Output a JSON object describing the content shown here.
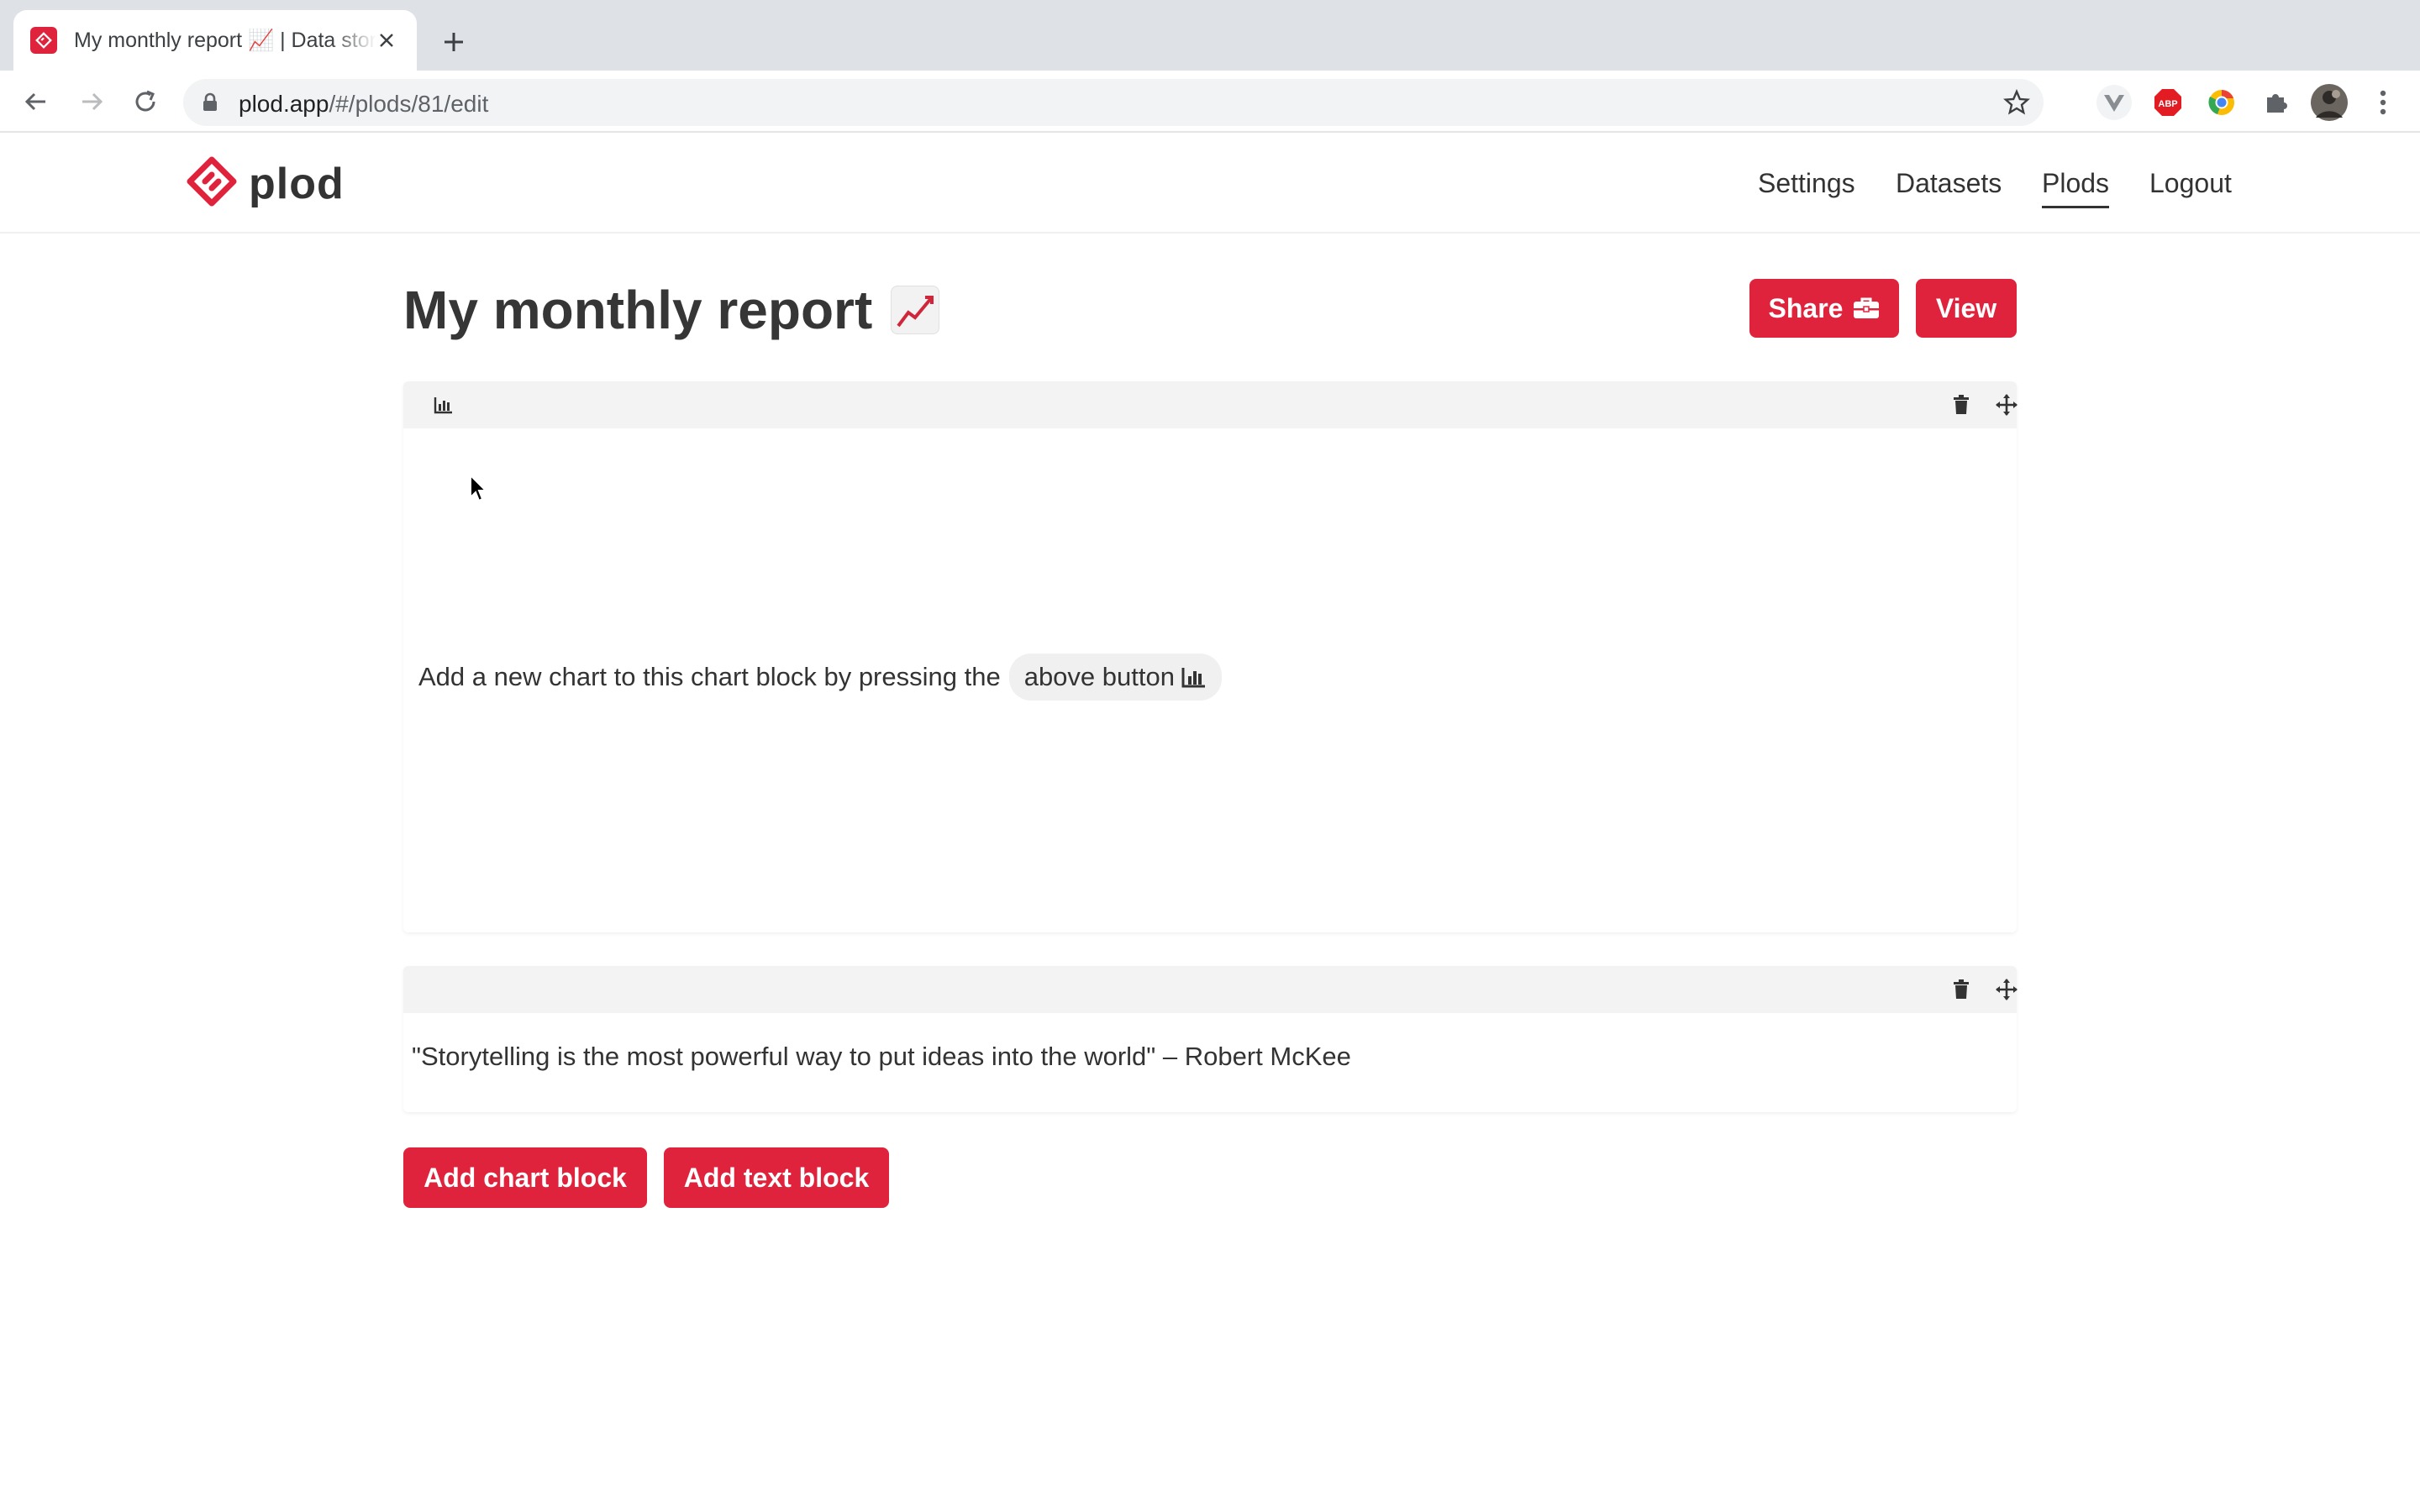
{
  "browser": {
    "tab_title": "My monthly report 📈 | Data stories",
    "url_host": "plod.app",
    "url_path": "/#/plods/81/edit"
  },
  "app": {
    "logo_text": "plod",
    "nav": [
      {
        "label": "Settings"
      },
      {
        "label": "Datasets"
      },
      {
        "label": "Plods",
        "active": true
      },
      {
        "label": "Logout"
      }
    ],
    "accent_color": "#e0233d"
  },
  "report": {
    "title": "My monthly report",
    "title_emoji": "chart-increasing-emoji",
    "share_label": "Share",
    "view_label": "View"
  },
  "blocks": {
    "chart_hint_text": "Add a new chart to this chart block by pressing the",
    "chart_hint_tag": "above button",
    "text_block_content": "\"Storytelling is the most powerful way to put ideas into the world\" – Robert McKee"
  },
  "actions": {
    "add_chart_label": "Add chart block",
    "add_text_label": "Add text block"
  }
}
